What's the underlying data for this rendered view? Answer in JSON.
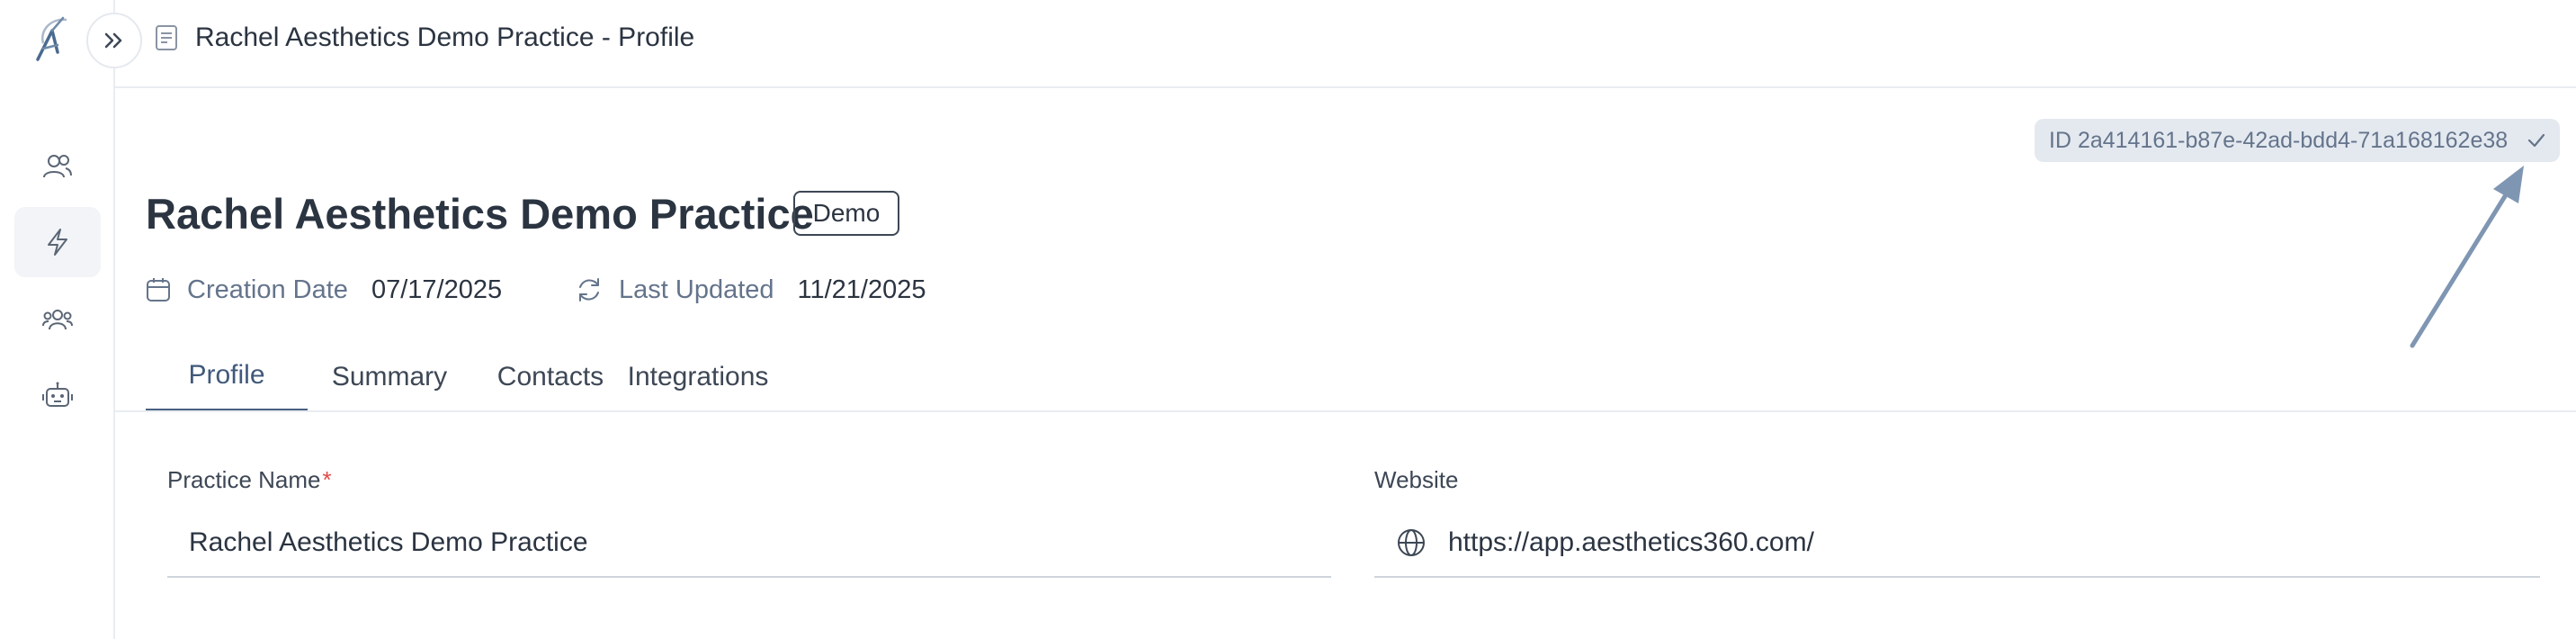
{
  "header": {
    "title": "Rachel Aesthetics Demo Practice - Profile"
  },
  "sidebar": {
    "items": [
      {
        "icon": "users-icon",
        "active": false
      },
      {
        "icon": "lightning-icon",
        "active": true
      },
      {
        "icon": "team-icon",
        "active": false
      },
      {
        "icon": "robot-icon",
        "active": false
      }
    ]
  },
  "record": {
    "id_text": "ID 2a414161-b87e-42ad-bdd4-71a168162e38",
    "name": "Rachel Aesthetics Demo Practice",
    "badge": "Demo",
    "creation_label": "Creation Date",
    "creation_value": "07/17/2025",
    "updated_label": "Last Updated",
    "updated_value": "11/21/2025"
  },
  "tabs": [
    {
      "label": "Profile",
      "active": true
    },
    {
      "label": "Summary",
      "active": false
    },
    {
      "label": "Contacts",
      "active": false
    },
    {
      "label": "Integrations",
      "active": false
    }
  ],
  "form": {
    "practice_name_label": "Practice Name",
    "practice_name_required": "*",
    "practice_name_value": "Rachel Aesthetics Demo Practice",
    "website_label": "Website",
    "website_value": "https://app.aesthetics360.com/"
  },
  "colors": {
    "accent": "#4a6182",
    "chip_bg": "#e4e9f0",
    "arrow": "#7f96b3",
    "required": "#e04848"
  }
}
